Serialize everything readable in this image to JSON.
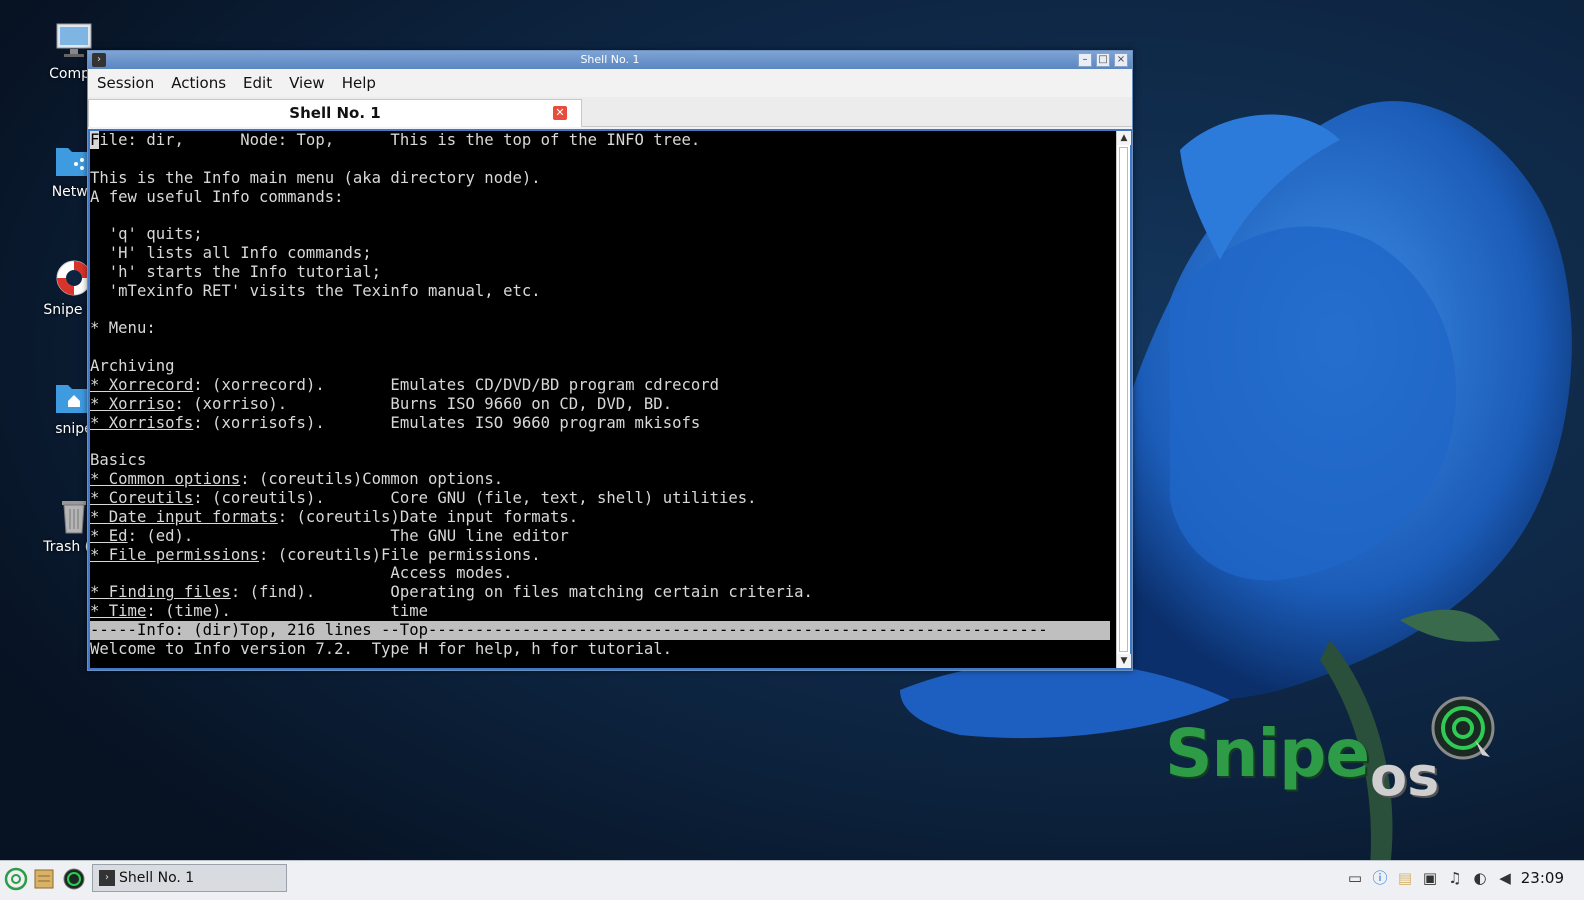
{
  "desktop": {
    "icons": [
      {
        "label": "Compu"
      },
      {
        "label": "Netwo"
      },
      {
        "label": "Snipe Su"
      },
      {
        "label": "snipe"
      },
      {
        "label": "Trash (Er"
      }
    ]
  },
  "window": {
    "title": "Shell No. 1",
    "menu": [
      "Session",
      "Actions",
      "Edit",
      "View",
      "Help"
    ],
    "tab_label": "Shell No. 1",
    "terminal_lines": [
      "File: dir,      Node: Top,      This is the top of the INFO tree.",
      "",
      "This is the Info main menu (aka directory node).",
      "A few useful Info commands:",
      "",
      "  'q' quits;",
      "  'H' lists all Info commands;",
      "  'h' starts the Info tutorial;",
      "  'mTexinfo RET' visits the Texinfo manual, etc.",
      "",
      "* Menu:",
      "",
      "Archiving",
      "* Xorrecord: (xorrecord).       Emulates CD/DVD/BD program cdrecord",
      "* Xorriso: (xorriso).           Burns ISO 9660 on CD, DVD, BD.",
      "* Xorrisofs: (xorrisofs).       Emulates ISO 9660 program mkisofs",
      "",
      "Basics",
      "* Common options: (coreutils)Common options.",
      "* Coreutils: (coreutils).       Core GNU (file, text, shell) utilities.",
      "* Date input formats: (coreutils)Date input formats.",
      "* Ed: (ed).                     The GNU line editor",
      "* File permissions: (coreutils)File permissions.",
      "                                Access modes.",
      "* Finding files: (find).        Operating on files matching certain criteria.",
      "* Time: (time).                 time"
    ],
    "mode_line": "-----Info: (dir)Top, 216 lines --Top------------------------------------------------------------------",
    "echo_line": "Welcome to Info version 7.2.  Type H for help, h for tutorial."
  },
  "branding": {
    "name": "Snipe",
    "suffix": "os",
    "green": "#2e9b47"
  },
  "taskbar": {
    "task_label": "Shell No. 1",
    "clock": "23:09"
  }
}
